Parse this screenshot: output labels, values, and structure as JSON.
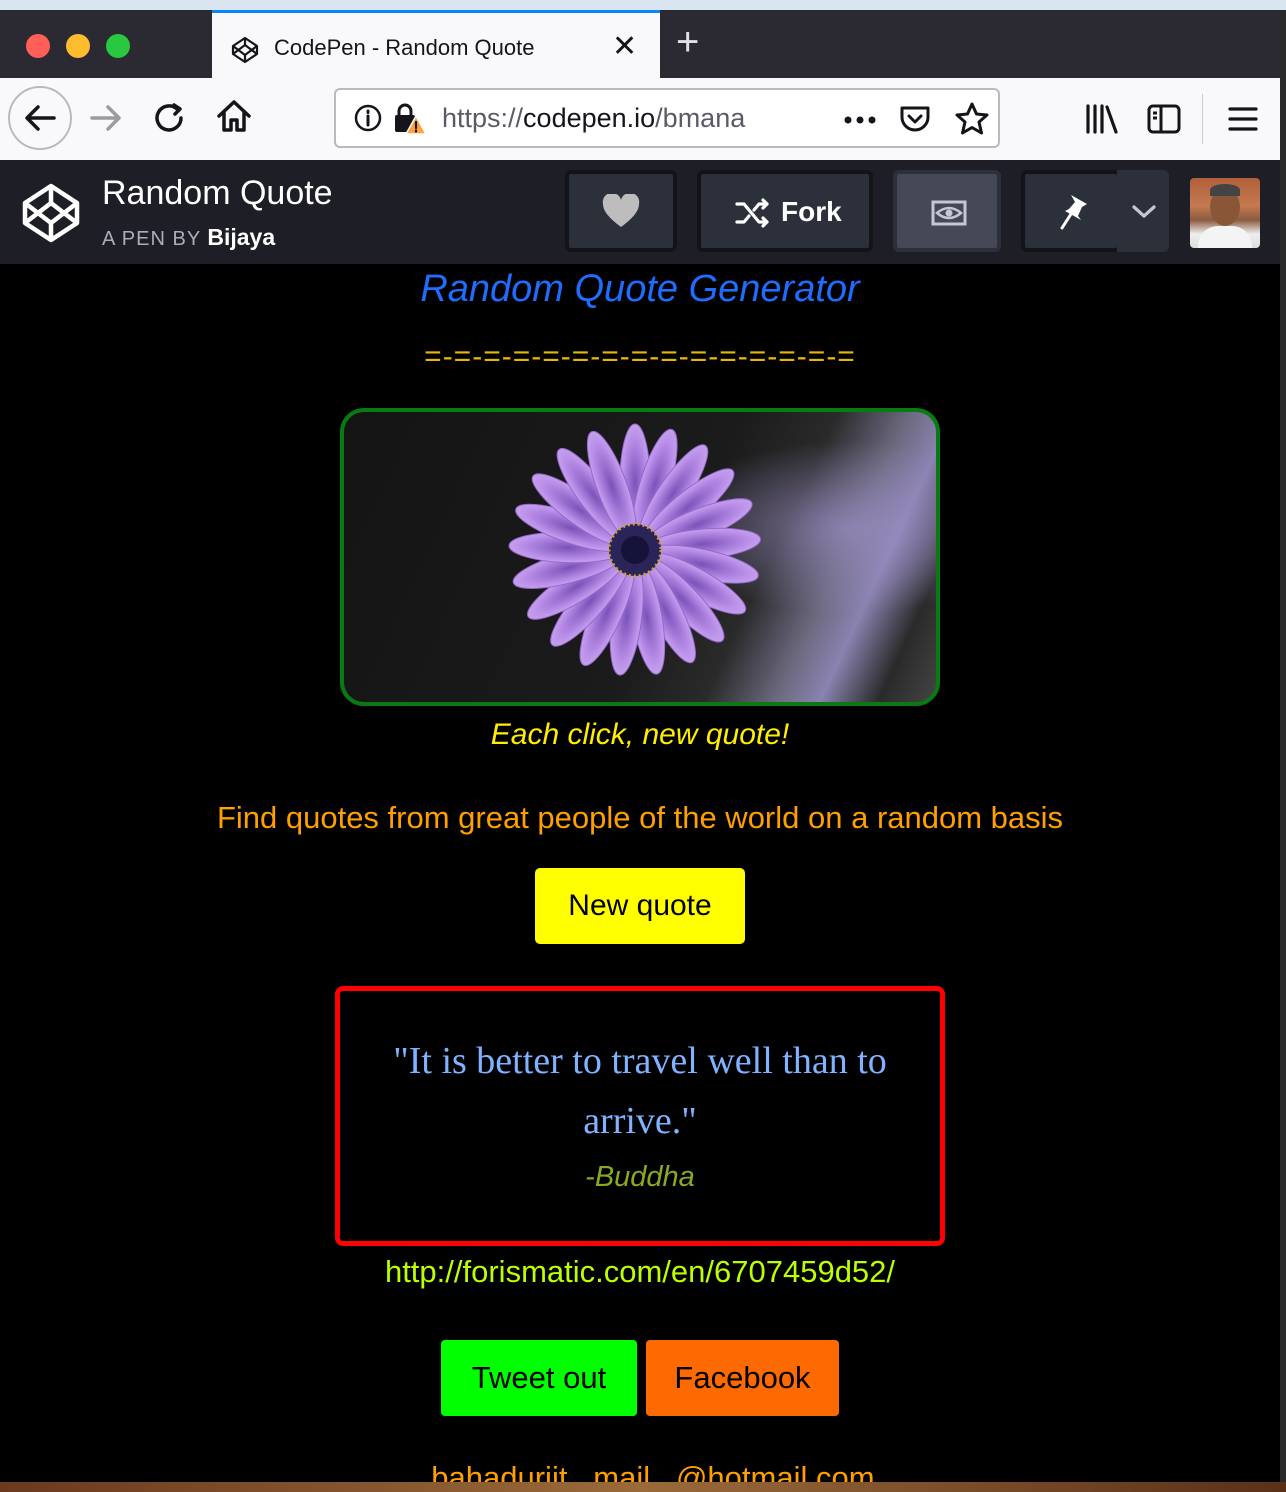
{
  "browser": {
    "tab": {
      "title": "CodePen - Random Quote"
    },
    "new_tab": "+",
    "close_tab": "✕",
    "url": {
      "scheme": "https://",
      "host": "codepen.io",
      "path": "/bmana"
    },
    "icons": [
      "back-icon",
      "forward-icon",
      "reload-icon",
      "home-icon",
      "info-icon",
      "insecure-lock-icon",
      "more-icon",
      "pocket-icon",
      "bookmark-star-icon",
      "library-icon",
      "sidebar-icon",
      "menu-icon"
    ]
  },
  "codepen": {
    "title": "Random Quote",
    "byline_prefix": "A PEN BY",
    "author": "Bijaya",
    "fork_label": "Fork"
  },
  "page": {
    "heading": "Random Quote Generator",
    "divider": "=-=-=-=-=-=-=-=-=-=-=-=-=-=-=",
    "caption": "Each click, new quote!",
    "subtitle": "Find quotes from great people of the world on a random basis",
    "new_quote_label": "New quote",
    "quote": "\"It is better to travel well than to arrive.\"",
    "author": "-Buddha",
    "link": "http://forismatic.com/en/6707459d52/",
    "tweet_label": "Tweet out",
    "facebook_label": "Facebook",
    "cut_off_text": "...bahadurjit...mail...@hotmail.com"
  },
  "colors": {
    "heading": "#1e6dff",
    "divider": "#e8b800",
    "caption": "#ffee00",
    "subtitle": "#ff9f00",
    "new_quote_bg": "#ffff00",
    "quote_border": "#ff0000",
    "quote_text": "#7fb2ff",
    "author": "#88aa22",
    "link": "#bbff00",
    "tweet_bg": "#00ff00",
    "facebook_bg": "#ff6a00",
    "flower_border": "#0a7a12"
  }
}
